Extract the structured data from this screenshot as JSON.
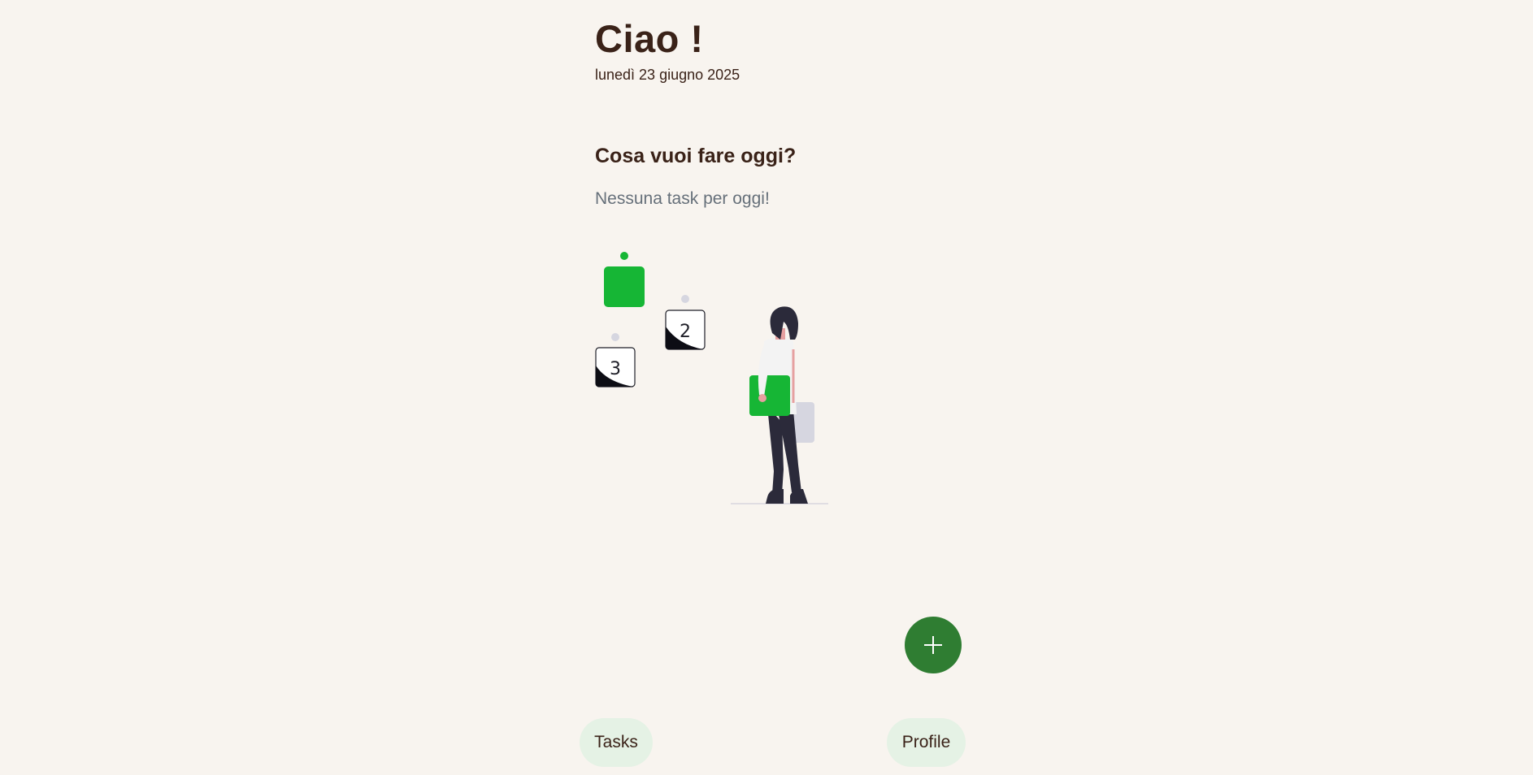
{
  "header": {
    "greeting": "Ciao !",
    "date": "lunedì 23 giugno 2025"
  },
  "main": {
    "question": "Cosa vuoi fare oggi?",
    "empty_message": "Nessuna task per oggi!",
    "illustration": {
      "numbers": [
        "2",
        "3"
      ],
      "accent_color": "#16b635"
    }
  },
  "fab": {
    "icon": "plus-icon",
    "color": "#2f7d32"
  },
  "bottom_nav": {
    "tasks_label": "Tasks",
    "profile_label": "Profile",
    "button_color": "#e5f2e5"
  },
  "colors": {
    "background": "#f8f4ef",
    "text_primary": "#3a2218",
    "text_muted": "#66707a"
  }
}
